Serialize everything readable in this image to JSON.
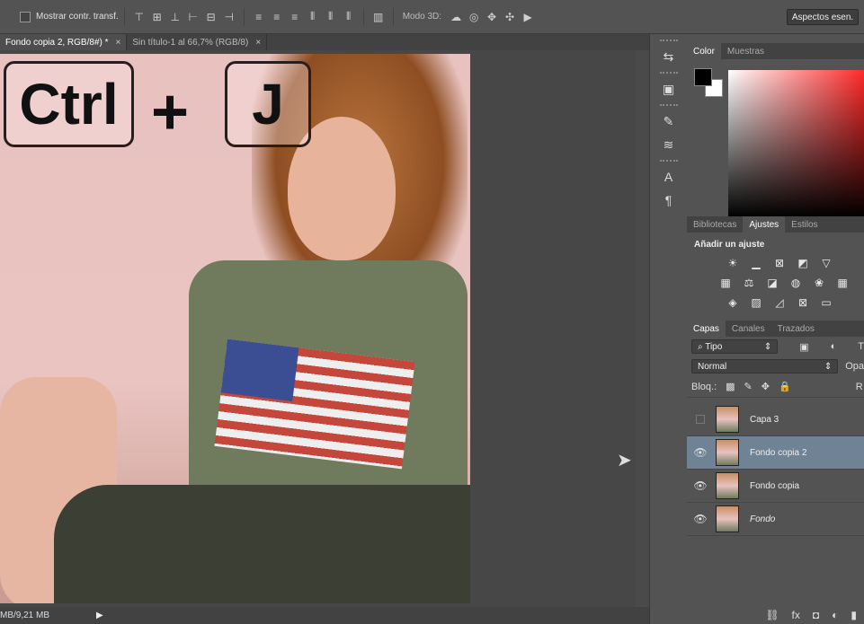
{
  "options_bar": {
    "show_transform_label": "Mostrar contr. transf.",
    "mode3d_label": "Modo 3D:",
    "workspace_button": "Aspectos esen."
  },
  "tabs": [
    {
      "label": "Fondo copia 2, RGB/8#) *",
      "close": "×"
    },
    {
      "label": "Sin título-1 al 66,7% (RGB/8)",
      "close": "×"
    }
  ],
  "overlay": {
    "key1": "Ctrl",
    "plus": "+",
    "key2": "J"
  },
  "status_bar": {
    "text": "MB/9,21 MB",
    "arrow": "▶"
  },
  "color_panel": {
    "tabs": [
      "Color",
      "Muestras"
    ],
    "foreground": "#000000",
    "background": "#ffffff",
    "hue": "#ff2a2a"
  },
  "adjust_panel": {
    "tabs": [
      "Bibliotecas",
      "Ajustes",
      "Estilos"
    ],
    "title": "Añadir un ajuste",
    "rows": [
      [
        "sun-icon",
        "levels-icon",
        "curves-icon",
        "exposure-icon",
        "triangle-icon"
      ],
      [
        "vibrance-icon",
        "balance-icon",
        "bw-icon",
        "photo-filter-icon",
        "mixer-icon",
        "lookup-icon"
      ],
      [
        "invert-icon",
        "posterize-icon",
        "threshold-icon",
        "selective-color-icon",
        "gradient-map-icon"
      ]
    ]
  },
  "layers_panel": {
    "tabs": [
      "Capas",
      "Canales",
      "Trazados"
    ],
    "filter_label": "Tipo",
    "blend_mode": "Normal",
    "opacity_label": "Opa",
    "lock_label": "Bloq.:",
    "fill_label": "R",
    "layers": [
      {
        "name": "Capa 3",
        "visible": false,
        "selected": false
      },
      {
        "name": "Fondo copia 2",
        "visible": true,
        "selected": true
      },
      {
        "name": "Fondo copia",
        "visible": true,
        "selected": false
      },
      {
        "name": "Fondo",
        "visible": true,
        "selected": false
      }
    ]
  }
}
